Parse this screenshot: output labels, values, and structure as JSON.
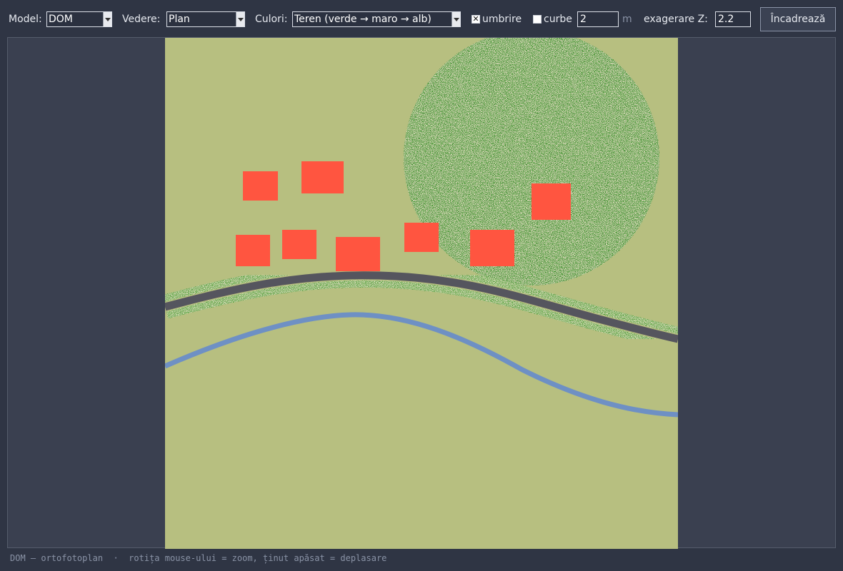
{
  "toolbar": {
    "model_label": "Model:",
    "model_value": "DOM",
    "view_label": "Vedere:",
    "view_value": "Plan",
    "colors_label": "Culori:",
    "colors_value": "Teren (verde → maro → alb)",
    "shading_label": "umbrire",
    "shading_checked": true,
    "contours_label": "curbe",
    "contours_checked": false,
    "contour_interval": "2",
    "contour_unit": "m",
    "zexag_label": "exagerare Z:",
    "zexag_value": "2.2",
    "fit_button": "Încadrează"
  },
  "status": {
    "text": "DOM — ortofotoplan  ·  rotița mouse-ului = zoom, ținut apăsat = deplasare"
  },
  "colors": {
    "background": "#2f3544",
    "viewport": "#3a4050",
    "terrain": "#b7bf80",
    "forest": "#0f7a06",
    "building": "#ff5540",
    "road": "#55555e",
    "road_verge": "#2f8f16",
    "river": "#6e90c4"
  }
}
